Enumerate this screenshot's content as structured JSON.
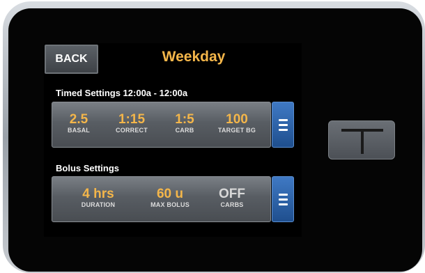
{
  "header": {
    "back_label": "BACK",
    "title": "Weekday"
  },
  "timed_settings": {
    "heading": "Timed Settings 12:00a - 12:00a",
    "items": [
      {
        "value": "2.5",
        "label": "BASAL"
      },
      {
        "value": "1:15",
        "label": "CORRECT"
      },
      {
        "value": "1:5",
        "label": "CARB"
      },
      {
        "value": "100",
        "label": "TARGET BG"
      }
    ],
    "menu_icon": "hamburger-icon"
  },
  "bolus_settings": {
    "heading": "Bolus Settings",
    "items": [
      {
        "value": "4 hrs",
        "label": "DURATION"
      },
      {
        "value": "60 u",
        "label": "MAX BOLUS"
      },
      {
        "value": "OFF",
        "label": "CARBS"
      }
    ],
    "menu_icon": "hamburger-icon"
  },
  "device": {
    "home_button_icon": "t-logo-icon"
  },
  "colors": {
    "accent": "#f4b64a",
    "menu_button": "#2f63a8",
    "screen_bg": "#000000",
    "bezel": "#050505"
  }
}
